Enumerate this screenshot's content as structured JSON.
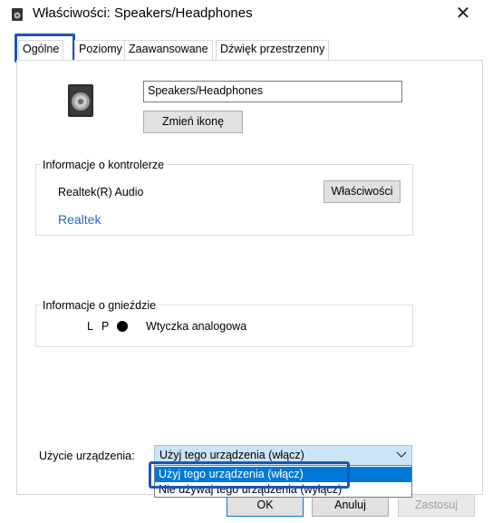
{
  "window": {
    "title": "Właściwości: Speakers/Headphones",
    "close_glyph": "✕",
    "icon": "speaker-icon"
  },
  "tabs": [
    {
      "label": "Ogólne",
      "active": true
    },
    {
      "label": "Poziomy",
      "active": false
    },
    {
      "label": "Zaawansowane",
      "active": false
    },
    {
      "label": "Dźwięk przestrzenny",
      "active": false
    }
  ],
  "general": {
    "device_icon": "speaker-icon",
    "device_name": "Speakers/Headphones",
    "change_icon_label": "Zmień ikonę"
  },
  "controller": {
    "legend": "Informacje o kontrolerze",
    "name": "Realtek(R) Audio",
    "properties_label": "Właściwości",
    "vendor_link": "Realtek"
  },
  "jack": {
    "legend": "Informacje o gnieździe",
    "channels": "L P",
    "connector": "Wtyczka analogowa"
  },
  "usage": {
    "label": "Użycie urządzenia:",
    "selected": "Użyj tego urządzenia (włącz)",
    "chevron": "chevron-down-icon",
    "options": [
      "Użyj tego urządzenia (włącz)",
      "Nie używaj tego urządzenia (wyłącz)"
    ]
  },
  "buttons": {
    "ok": "OK",
    "cancel": "Anuluj",
    "apply": "Zastosuj"
  },
  "colors": {
    "accent": "#1a55b8",
    "selection": "#0078d7",
    "link": "#2a66c1"
  }
}
